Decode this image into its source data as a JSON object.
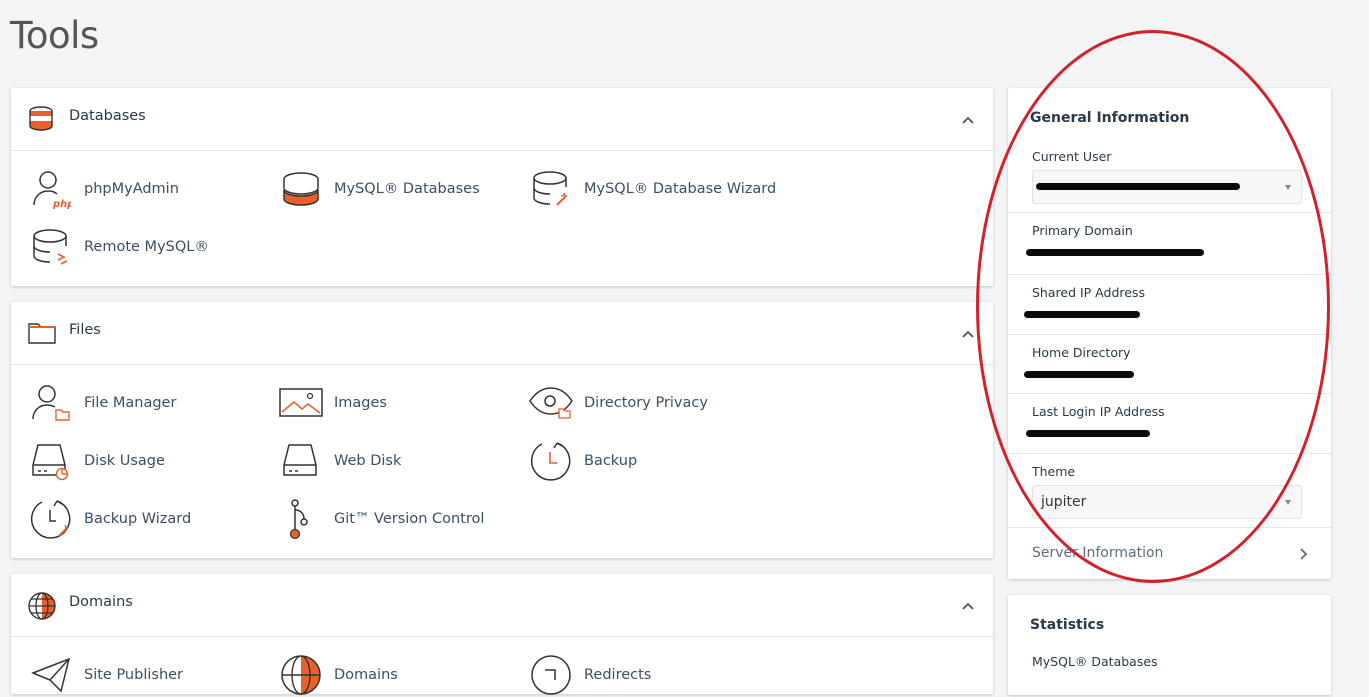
{
  "page": {
    "title": "Tools"
  },
  "colors": {
    "accent": "#e8602c",
    "text": "#293a4a",
    "link": "#3b4f66",
    "annotation": "#d3202a"
  },
  "sections": {
    "databases": {
      "title": "Databases",
      "icon": "database-stack-icon",
      "items": [
        {
          "label": "phpMyAdmin",
          "icon": "php-user-icon"
        },
        {
          "label": "MySQL® Databases",
          "icon": "database-icon"
        },
        {
          "label": "MySQL® Database Wizard",
          "icon": "database-wizard-icon"
        },
        {
          "label": "Remote MySQL®",
          "icon": "remote-database-icon"
        }
      ]
    },
    "files": {
      "title": "Files",
      "icon": "folder-icon",
      "items": [
        {
          "label": "File Manager",
          "icon": "user-folder-icon"
        },
        {
          "label": "Images",
          "icon": "image-icon"
        },
        {
          "label": "Directory Privacy",
          "icon": "eye-folder-icon"
        },
        {
          "label": "Disk Usage",
          "icon": "disk-usage-icon"
        },
        {
          "label": "Web Disk",
          "icon": "web-disk-icon"
        },
        {
          "label": "Backup",
          "icon": "backup-clock-icon"
        },
        {
          "label": "Backup Wizard",
          "icon": "backup-wizard-icon"
        },
        {
          "label": "Git™ Version Control",
          "icon": "git-branch-icon"
        }
      ]
    },
    "domains": {
      "title": "Domains",
      "icon": "globe-icon",
      "items": [
        {
          "label": "Site Publisher",
          "icon": "paper-plane-icon"
        },
        {
          "label": "Domains",
          "icon": "globe-domains-icon"
        },
        {
          "label": "Redirects",
          "icon": "redirect-icon"
        }
      ]
    }
  },
  "general_info": {
    "title": "General Information",
    "current_user_label": "Current User",
    "primary_domain_label": "Primary Domain",
    "shared_ip_label": "Shared IP Address",
    "home_dir_label": "Home Directory",
    "last_login_label": "Last Login IP Address",
    "theme_label": "Theme",
    "theme_value": "jupiter",
    "server_info_label": "Server Information"
  },
  "statistics": {
    "title": "Statistics",
    "first_item_label": "MySQL® Databases"
  }
}
